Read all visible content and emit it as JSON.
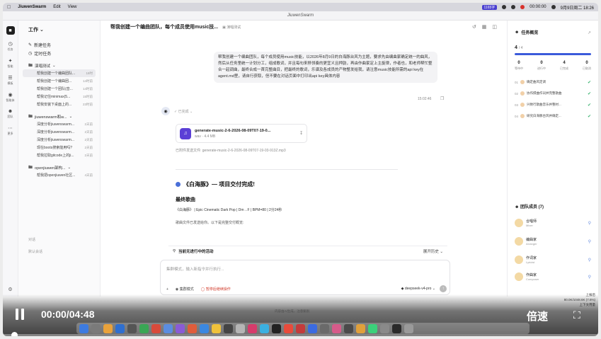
{
  "menubar": {
    "app_name": "JiuwenSwarm",
    "menus": [
      "Edit",
      "View"
    ],
    "badge": "1165字",
    "clock_text": "00:00:00",
    "datetime": "9月9日周二 18:26"
  },
  "window_title": "JiuwenSwarm",
  "rail": {
    "items": [
      "任务",
      "智能",
      "模板",
      "智能体",
      "团队",
      "更多"
    ]
  },
  "sidebar": {
    "workspace": "工作",
    "new_task": "新建任务",
    "scheduled": "定时任务",
    "groups": [
      {
        "name": "演唱测试",
        "threads": [
          {
            "title": "帮我创建一个编曲团队...",
            "time": "18时",
            "active": true
          },
          {
            "title": "帮我创建一个编曲团...",
            "time": "14时前"
          },
          {
            "title": "帮我创建一个团队(音...",
            "time": "14时前"
          },
          {
            "title": "帮我记住minimax(5...",
            "time": "15时前"
          },
          {
            "title": "帮我安装下桌面上的...",
            "time": "23时前"
          }
        ]
      },
      {
        "name": "jiuwenswarm和w...",
        "threads": [
          {
            "title": "深度分析jiuwenswarm...",
            "time": "2天前"
          },
          {
            "title": "深度分析jiuwenswarm...",
            "time": "2天前"
          },
          {
            "title": "深度分析jiuwenswarm...",
            "time": "2天前"
          },
          {
            "title": "现在boots搜索能用吗?",
            "time": "2天前"
          },
          {
            "title": "帮我拉取gitcode上的ji...",
            "time": "2天前"
          }
        ]
      },
      {
        "name": "openjiuwen架构...",
        "threads": [
          {
            "title": "帮我把openjiuwen社区...",
            "time": "4天前"
          }
        ]
      }
    ],
    "footer_a": "对话",
    "footer_b": "默认会话"
  },
  "chat": {
    "title": "帮我创建一个编曲团队，每个成员使用music技...",
    "tag": "演唱测试",
    "user_message": "帮我创建一个编曲团队，每个成员使用music技能，以2026年8月9日的白海豚台风为主题，要求先由编曲家确定统一的曲风，然后从任务里统一计划分工，组成歌词，并且每句来移领奏的更宜义且押韵，再由作曲家定上主旋律，作者也，和老师帮忙整合一起调曲，最终合成一首完整曲目，把最终的歌词，乐谱及各成员的产物整发给我，请注意music技能所需的api key在agent.md里，请自行获取，但不要在对话页面中打印出api key具体内容",
    "user_time": "15:02:46",
    "status": "已完成",
    "file": {
      "name": "generate-music-2-6-2026-08-09T07-19-0...",
      "size": "wav · 4.4 MB",
      "sent_text": "已附件发送文件: generate-music-2-6-2026-08-09T07-19-03-913Z.mp3"
    },
    "delivery_title": "《白海豚》— 项目交付完成!",
    "final_song_heading": "最终歌曲",
    "song_info": "《白海豚》 | Epic Cinematic Dark Pop | Dm→F | BPM=80 | 2分24秒",
    "song_note": "歌曲文件已发送给你。以下是完整交付概览:",
    "activity_label": "当前无进行中的活动",
    "activity_toggle": "展开历史",
    "input_placeholder": "集群模式，输入新指令并行执行...",
    "tool_mode": "集群模式",
    "tool_pause": "暂停后继续操作",
    "model": "deepseek-v4-pro",
    "footer": "内容由AI生成，注意甄别"
  },
  "right_panel": {
    "title": "任务概览",
    "progress_done": "4",
    "progress_total": "/ 4",
    "progress_fraction": 1.0,
    "stats": [
      {
        "n": "0",
        "l": "等待中"
      },
      {
        "n": "0",
        "l": "进行中"
      },
      {
        "n": "4",
        "l": "已完成"
      },
      {
        "n": "0",
        "l": "已取消"
      }
    ],
    "tasks": [
      {
        "num": "01",
        "text": "确定曲风定调"
      },
      {
        "num": "02",
        "text": "协作撰曲作词并完整歌曲"
      },
      {
        "num": "03",
        "text": "兴致行歌曲音乐并整材..."
      },
      {
        "num": "04",
        "text": "研究白海豚台风并确定..."
      }
    ],
    "team_title": "团队成员 (7)",
    "members": [
      {
        "name": "合唱师",
        "role": "Mixer"
      },
      {
        "name": "编曲家",
        "role": "Arranger"
      },
      {
        "name": "作词家",
        "role": "Lyricist"
      },
      {
        "name": "作曲家",
        "role": "Composer"
      }
    ]
  },
  "status_lines": [
    "上报后",
    "80.0K/1048.6K (7.6%)",
    "上下文用量"
  ],
  "video": {
    "time": "00:00/04:48",
    "speed_label": "倍速"
  }
}
